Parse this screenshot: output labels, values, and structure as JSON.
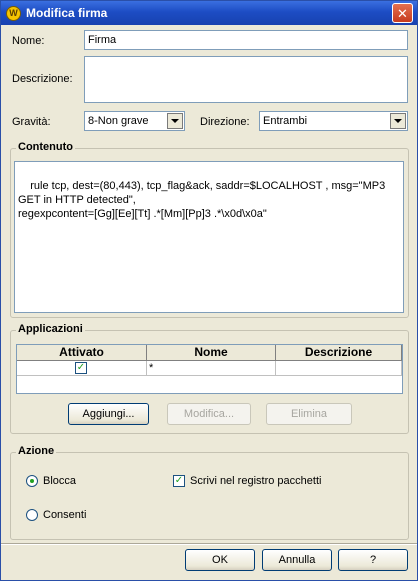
{
  "window": {
    "title": "Modifica firma",
    "icon": "shield-icon"
  },
  "form": {
    "name_label": "Nome:",
    "name_value": "Firma",
    "description_label": "Descrizione:",
    "description_value": "",
    "severity_label": "Gravità:",
    "severity_value": "8-Non grave",
    "direction_label": "Direzione:",
    "direction_value": "Entrambi"
  },
  "content": {
    "title": "Contenuto",
    "text": "rule tcp, dest=(80,443), tcp_flag&ack, saddr=$LOCALHOST , msg=\"MP3 GET in HTTP detected\",\nregexpcontent=[Gg][Ee][Tt] .*[Mm][Pp]3 .*\\x0d\\x0a\""
  },
  "applications": {
    "title": "Applicazioni",
    "columns": [
      "Attivato",
      "Nome",
      "Descrizione"
    ],
    "rows": [
      {
        "enabled": true,
        "name": "*",
        "description": ""
      }
    ],
    "add_label": "Aggiungi...",
    "edit_label": "Modifica...",
    "delete_label": "Elimina"
  },
  "action": {
    "title": "Azione",
    "block_label": "Blocca",
    "block_selected": true,
    "allow_label": "Consenti",
    "allow_selected": false,
    "log_label": "Scrivi nel registro pacchetti",
    "log_checked": true
  },
  "footer": {
    "ok_label": "OK",
    "cancel_label": "Annulla",
    "help_label": "?"
  }
}
